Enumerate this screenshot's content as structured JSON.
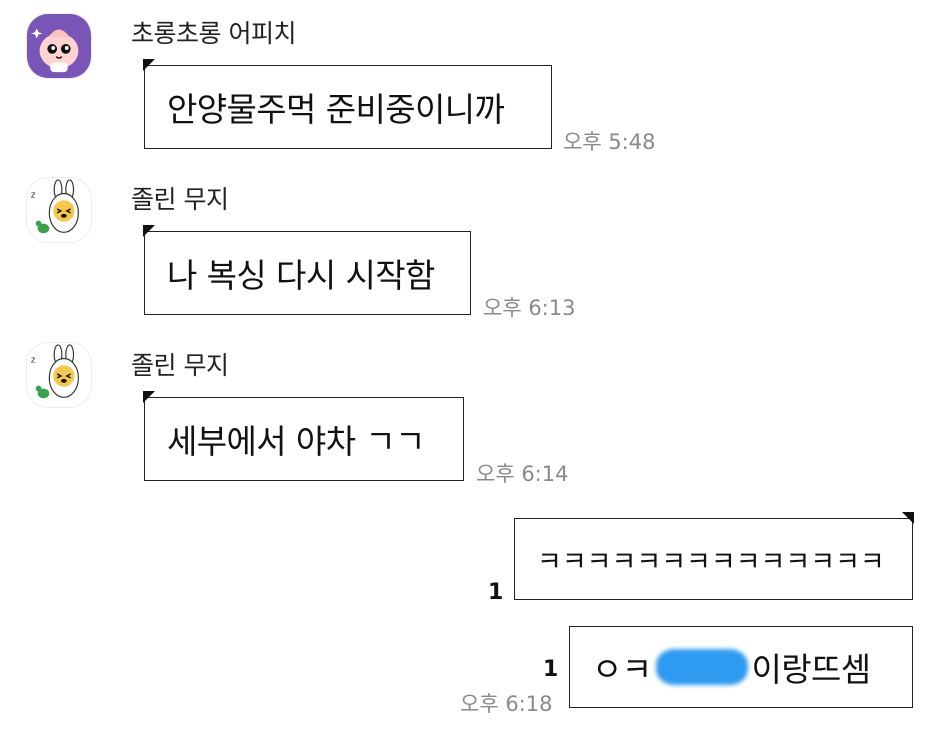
{
  "messages": [
    {
      "sender": "초롱초롱 어피치",
      "avatar_icon": "apeach-avatar-icon",
      "text": "안양물주먹 준비중이니까",
      "time": "오후 5:48"
    },
    {
      "sender": "졸린 무지",
      "avatar_icon": "muzi-avatar-icon",
      "text": "나 복싱 다시 시작함",
      "time": "오후 6:13"
    },
    {
      "sender": "졸린 무지",
      "avatar_icon": "muzi-avatar-icon",
      "text": "세부에서 야차 ㄱㄱ",
      "time": "오후 6:14"
    }
  ],
  "my_messages": [
    {
      "text": "ㅋㅋㅋㅋㅋㅋㅋㅋㅋㅋㅋㅋㅋㅋ",
      "unread": "1"
    },
    {
      "text_before": "ㅇㅋ",
      "redacted_icon": "blue-scribble-redaction",
      "text_after": "이랑뜨셈",
      "unread": "1",
      "time": "오후 6:18"
    }
  ],
  "colors": {
    "apeach_bg": "#7a55b8",
    "muzi_yellow": "#f7c94a",
    "redaction": "#2f9bf0",
    "time_gray": "#8a8a8a"
  }
}
